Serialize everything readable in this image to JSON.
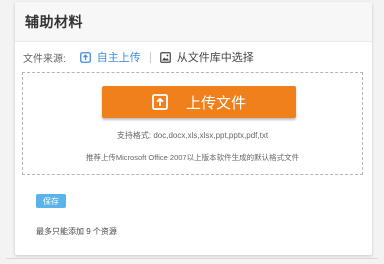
{
  "section": {
    "title": "辅助材料"
  },
  "source": {
    "label": "文件来源:",
    "options": [
      {
        "label": "自主上传",
        "icon": "upload-square-icon",
        "active": true
      },
      {
        "label": "从文件库中选择",
        "icon": "image-icon",
        "active": false
      }
    ]
  },
  "dropzone": {
    "upload_button_label": "上传文件",
    "supported_formats": "支持格式: doc,docx,xls,xlsx,ppt,pptx,pdf,txt",
    "recommendation": "推荐上传Microsoft Office 2007以上版本软件生成的默认格式文件"
  },
  "actions": {
    "save_label": "保存"
  },
  "footer": {
    "limit_note": "最多只能添加 9 个资源"
  },
  "colors": {
    "accent_blue": "#3c8dde",
    "upload_orange": "#f0801c",
    "save_blue": "#5ab4ea"
  }
}
